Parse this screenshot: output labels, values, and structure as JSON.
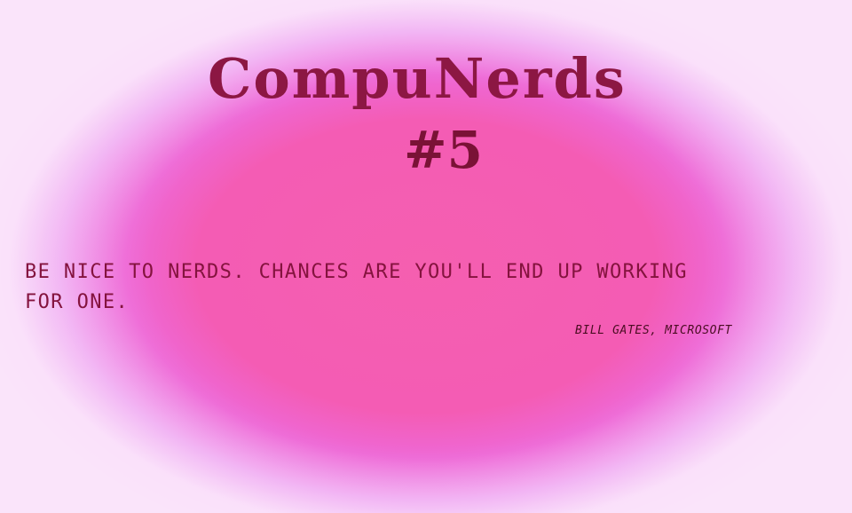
{
  "poster": {
    "title": "CompuNerds",
    "number": "#5",
    "quote_line_1": "BE NICE TO NERDS. CHANCES ARE YOU'LL END UP WORKING",
    "quote_line_2": "FOR ONE.",
    "attribution": "BILL GATES, MICROSOFT"
  },
  "colors": {
    "background_center": "#f55fb0",
    "background_edge": "#f8d6f8",
    "title_text": "#8c1743",
    "quote_text": "#84133e",
    "attribution_text": "#4a0d22"
  }
}
